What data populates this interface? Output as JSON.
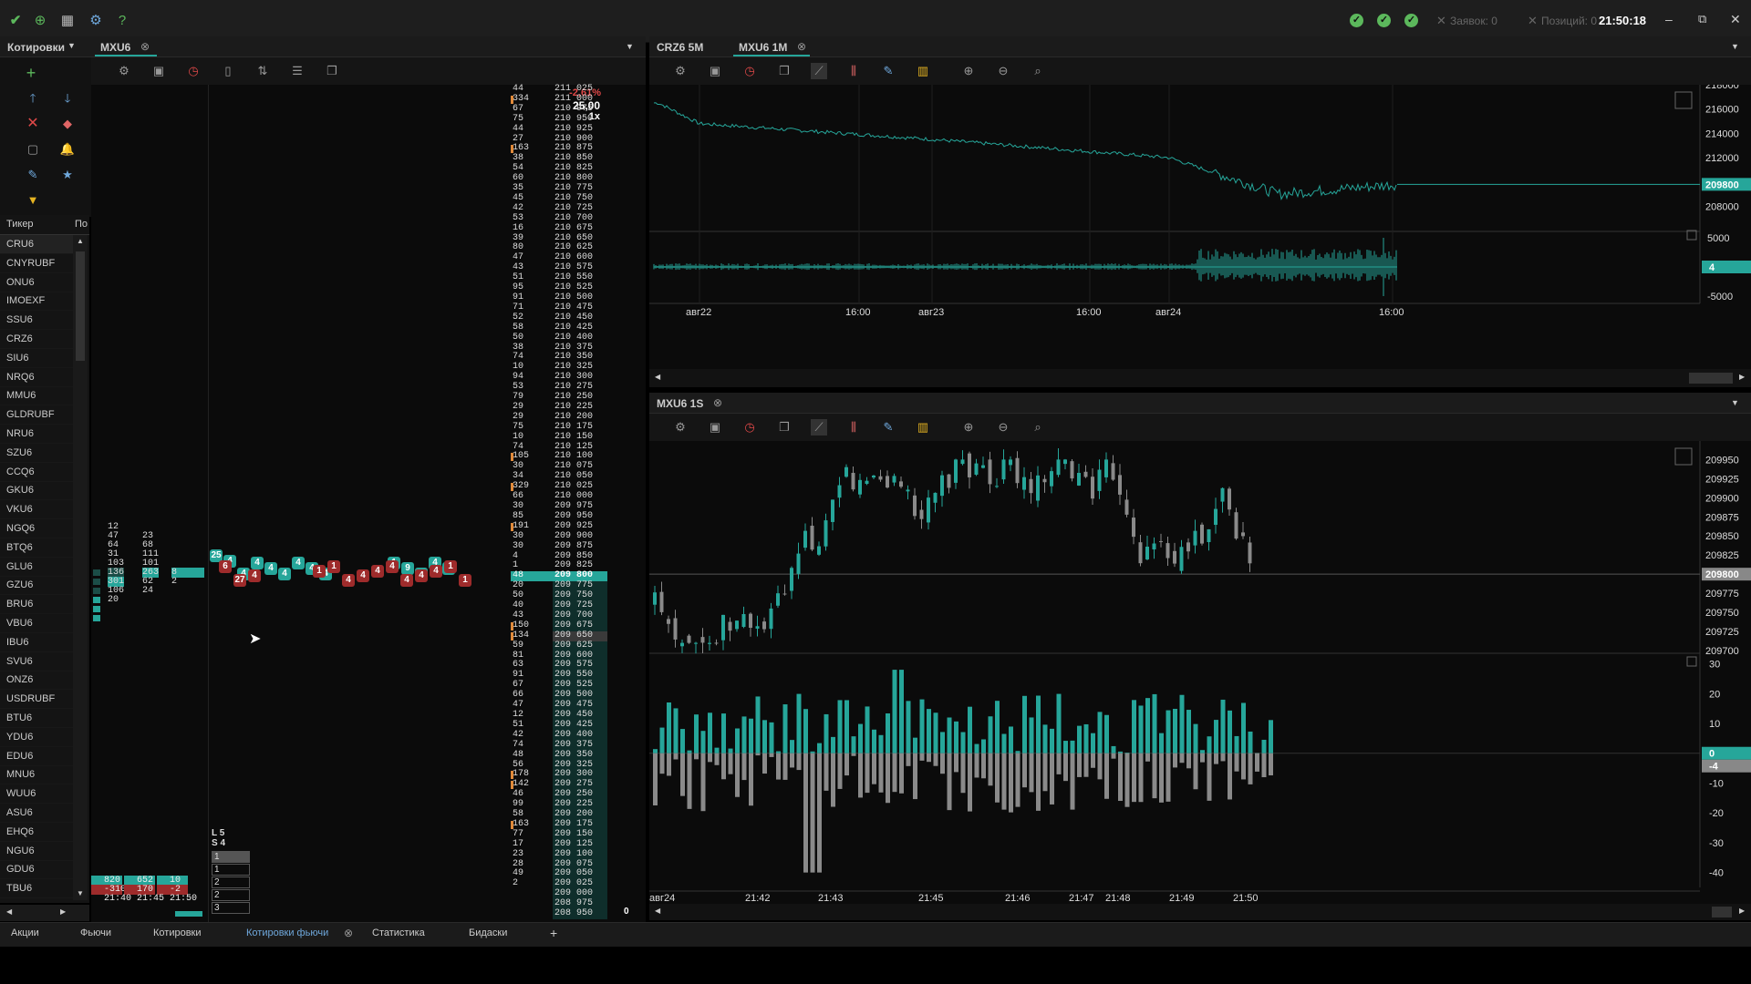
{
  "titlebar": {
    "status": {
      "orders": "Заявок: 0",
      "positions": "Позиций: 0"
    },
    "clock": "21:50:18"
  },
  "left": {
    "tab_quotes": "Котировки",
    "tab_mxu6": "MXU6",
    "table": {
      "col_ticker": "Тикер",
      "col_other": "По"
    },
    "tickers": [
      "CRU6",
      "CNYRUBF",
      "ONU6",
      "IMOEXF",
      "SSU6",
      "CRZ6",
      "SIU6",
      "NRQ6",
      "MMU6",
      "GLDRUBF",
      "NRU6",
      "SZU6",
      "CCQ6",
      "GKU6",
      "VKU6",
      "NGQ6",
      "BTQ6",
      "GLU6",
      "GZU6",
      "BRU6",
      "VBU6",
      "IBU6",
      "SVU6",
      "ONZ6",
      "USDRUBF",
      "BTU6",
      "YDU6",
      "EDU6",
      "MNU6",
      "WUU6",
      "ASU6",
      "EHQ6",
      "NGU6",
      "GDU6",
      "TBU6"
    ]
  },
  "dom": {
    "change": "-2,61%",
    "lot": "25,00",
    "mult": "1x",
    "last_price": "209 800",
    "bottom_value": "0",
    "ls": {
      "l": "L 5",
      "s": "S 4"
    },
    "ls_values": [
      "1",
      "1",
      "2",
      "2",
      "3"
    ],
    "bottom_rows": [
      [
        "820",
        "652",
        "10"
      ],
      [
        "-310",
        "170",
        "-2"
      ],
      [
        "21:40",
        "21:45",
        "21:50"
      ]
    ],
    "mini_asks": [
      "12",
      "47",
      "64",
      "31",
      "103",
      "136"
    ],
    "mini_asks2": [
      "23",
      "68",
      "111",
      "101",
      "263"
    ],
    "mini_bids": [
      "301",
      "106",
      "20"
    ],
    "mini_bids2": [
      "62",
      "24"
    ],
    "mini_mid": [
      "8",
      "2"
    ],
    "bubbles_green": [
      "25",
      "4",
      "4",
      "4",
      "4",
      "4",
      "4",
      "4",
      "4",
      "1",
      "9",
      "4",
      "4",
      "1"
    ],
    "bubbles_red": [
      "6",
      "27",
      "4",
      "1",
      "1",
      "4",
      "4",
      "4",
      "4",
      "4",
      "4",
      "4",
      "1",
      "1"
    ],
    "volumes": [
      "44",
      "334",
      "67",
      "75",
      "44",
      "27",
      "163",
      "38",
      "54",
      "60",
      "35",
      "45",
      "42",
      "53",
      "16",
      "39",
      "80",
      "47",
      "43",
      "51",
      "95",
      "91",
      "71",
      "52",
      "58",
      "50",
      "38",
      "74",
      "10",
      "94",
      "53",
      "79",
      "29",
      "29",
      "75",
      "10",
      "74",
      "105",
      "30",
      "34",
      "329",
      "66",
      "30",
      "85",
      "191",
      "30",
      "30",
      "4",
      "1",
      "48",
      "20",
      "50",
      "40",
      "43",
      "150",
      "134",
      "59",
      "81",
      "63",
      "91",
      "67",
      "66",
      "47",
      "12",
      "51",
      "42",
      "74",
      "48",
      "56",
      "178",
      "142",
      "46",
      "99",
      "58",
      "163",
      "77",
      "17",
      "23",
      "28",
      "49",
      "2"
    ],
    "prices": [
      "211 025",
      "211 000",
      "210 975",
      "210 950",
      "210 925",
      "210 900",
      "210 875",
      "210 850",
      "210 825",
      "210 800",
      "210 775",
      "210 750",
      "210 725",
      "210 700",
      "210 675",
      "210 650",
      "210 625",
      "210 600",
      "210 575",
      "210 550",
      "210 525",
      "210 500",
      "210 475",
      "210 450",
      "210 425",
      "210 400",
      "210 375",
      "210 350",
      "210 325",
      "210 300",
      "210 275",
      "210 250",
      "210 225",
      "210 200",
      "210 175",
      "210 150",
      "210 125",
      "210 100",
      "210 075",
      "210 050",
      "210 025",
      "210 000",
      "209 975",
      "209 950",
      "209 925",
      "209 900",
      "209 875",
      "209 850",
      "209 825",
      "209 800",
      "209 775",
      "209 750",
      "209 725",
      "209 700",
      "209 675",
      "209 650",
      "209 625",
      "209 600",
      "209 575",
      "209 550",
      "209 525",
      "209 500",
      "209 475",
      "209 450",
      "209 425",
      "209 400",
      "209 375",
      "209 350",
      "209 325",
      "209 300",
      "209 275",
      "209 250",
      "209 225",
      "209 200",
      "209 175",
      "209 150",
      "209 125",
      "209 100",
      "209 075",
      "209 050",
      "209 025",
      "209 000",
      "208 975",
      "208 950"
    ]
  },
  "chart1": {
    "tab_a": "CRZ6 5M",
    "tab_b": "MXU6 1M",
    "y_labels": [
      "218000",
      "216000",
      "214000",
      "212000",
      "210000",
      "208000"
    ],
    "y_current": "209800",
    "vol_labels": [
      "5000",
      "-5000"
    ],
    "vol_current": "4",
    "x_labels": [
      "авг22",
      "16:00",
      "авг23",
      "16:00",
      "авг24",
      "16:00"
    ]
  },
  "chart2": {
    "tab": "MXU6 1S",
    "y_labels": [
      "209950",
      "209925",
      "209900",
      "209875",
      "209850",
      "209825",
      "209775",
      "209750",
      "209725",
      "209700"
    ],
    "y_current": "209800",
    "vol_labels": [
      "30",
      "20",
      "10",
      "-10",
      "-20",
      "-30",
      "-40"
    ],
    "vol_current": "0",
    "vol_current2": "-4",
    "x_labels": [
      "авг24",
      "21:42",
      "21:43",
      "21:45",
      "21:46",
      "21:47",
      "21:48",
      "21:49",
      "21:50"
    ]
  },
  "bottom_tabs": [
    "Акции",
    "Фьючи",
    "Котировки",
    "Котировки фьючи",
    "Статистика",
    "Бидаски"
  ],
  "colors": {
    "accent": "#26a69a",
    "down": "#9e2b2b",
    "gray_bar": "#8a8a8a",
    "ok": "#5cb85c",
    "change": "#e04848"
  },
  "chart_data": [
    {
      "type": "line",
      "title": "MXU6 1M",
      "x": [
        "авг22",
        "16:00",
        "авг23",
        "16:00",
        "авг24",
        "16:00"
      ],
      "series": [
        {
          "values": [
            216500,
            214800,
            213500,
            212000,
            209000,
            209800
          ]
        }
      ],
      "ylim": [
        206000,
        218000
      ]
    },
    {
      "type": "bar",
      "title": "MXU6 1S",
      "categories": [
        "21:42",
        "21:43",
        "21:45",
        "21:46",
        "21:47",
        "21:48",
        "21:49",
        "21:50"
      ],
      "series": [
        {
          "values": [
            20,
            -35,
            30,
            25,
            15,
            10,
            15,
            0
          ]
        }
      ],
      "ylim": [
        -45,
        32
      ]
    }
  ]
}
